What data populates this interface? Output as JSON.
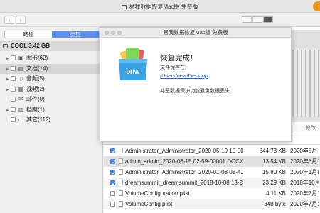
{
  "window": {
    "title": "易我数据恢复Mac版 免费版",
    "badge": ""
  },
  "nav": {
    "back": "‹",
    "forward": "›"
  },
  "sidebar": {
    "segments": [
      {
        "label": "路径",
        "active": false
      },
      {
        "label": "类型",
        "active": true
      }
    ],
    "volume": "COOL 3.42 GB",
    "items": [
      {
        "label": "图形(62)",
        "icon": "image-icon",
        "glyph": "▣",
        "expandable": true,
        "selected": false
      },
      {
        "label": "文档(14)",
        "icon": "document-icon",
        "glyph": "▤",
        "expandable": true,
        "selected": true
      },
      {
        "label": "音频(5)",
        "icon": "music-icon",
        "glyph": "♫",
        "expandable": true,
        "selected": false
      },
      {
        "label": "视频(2)",
        "icon": "video-icon",
        "glyph": "▦",
        "expandable": true,
        "selected": false
      },
      {
        "label": "邮件(0)",
        "icon": "mail-icon",
        "glyph": "✉",
        "expandable": false,
        "selected": false
      },
      {
        "label": "档案(1)",
        "icon": "archive-icon",
        "glyph": "▥",
        "expandable": true,
        "selected": false
      },
      {
        "label": "其它(112)",
        "icon": "other-icon",
        "glyph": "▭",
        "expandable": false,
        "selected": false
      }
    ]
  },
  "list": {
    "header_right": "修改",
    "rows": [
      {
        "checked": true,
        "name": "Administrator_Administrator_2020-05-19 10-00...",
        "size": "344.73 KB",
        "date": "2020年5月"
      },
      {
        "checked": true,
        "name": "admin_admin_2020-06-15 02-59-00001.DOCX",
        "size": "13.54 KB",
        "date": "2020年6月14日"
      },
      {
        "checked": true,
        "name": "Administrator_Administrator_2020-01-08 08-4...",
        "size": "15.80 KB",
        "date": "2020年1月8日"
      },
      {
        "checked": true,
        "name": "dreamsummit_dreamsummit_2018-10-08 13-23...",
        "size": "23.29 KB",
        "date": "2018年10月8日"
      },
      {
        "checked": false,
        "name": "VolumeConfiguration.plist",
        "size": "4.11 KB",
        "date": "2020年7月13日"
      },
      {
        "checked": false,
        "name": "VolumeConfig.plist",
        "size": "348 byte",
        "date": "2020年7月13日"
      }
    ]
  },
  "modal": {
    "title": "易我数据恢复Mac版 免费版",
    "heading": "恢复完成！",
    "label": "文件保存在:",
    "path": "/Users/new/Desktop",
    "note": "并恶数据保护功能避免数据丢失",
    "icon_text": "DRW"
  },
  "colors": {
    "accent": "#5b8ff0",
    "link": "#2a63d4",
    "check": "#3b82f6",
    "orange": "#f0961f"
  }
}
